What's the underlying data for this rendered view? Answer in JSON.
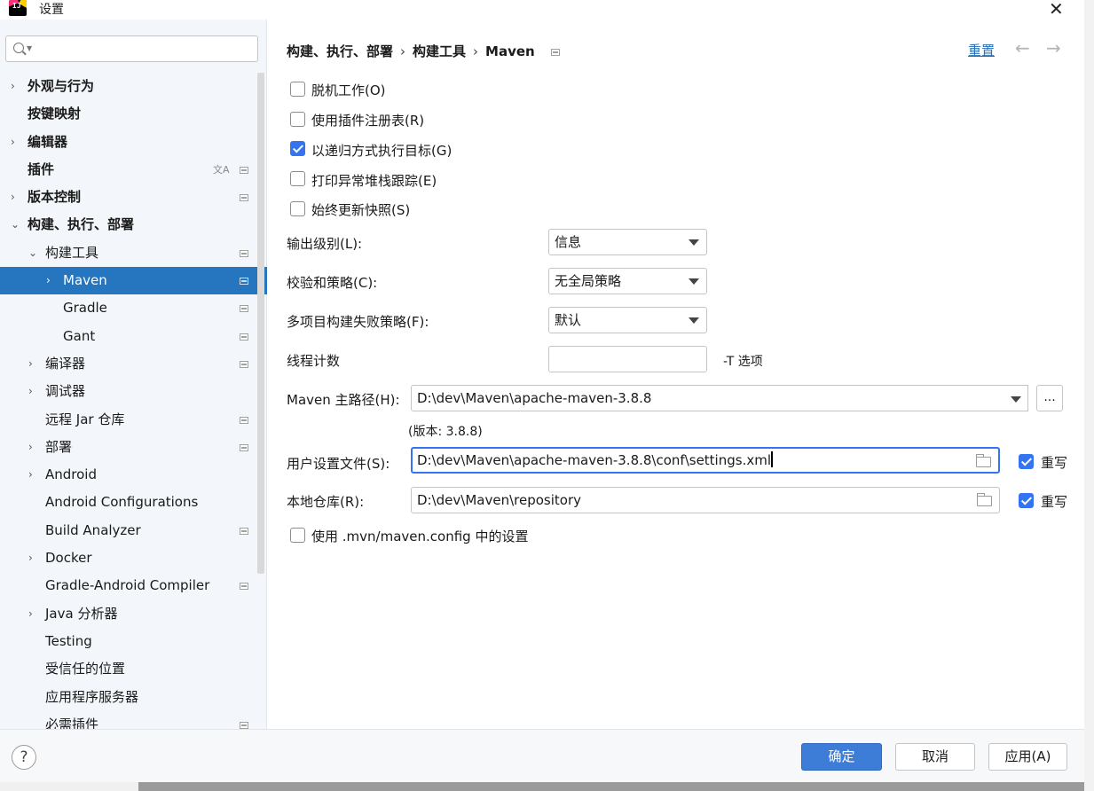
{
  "window": {
    "title": "设置",
    "close_glyph": "✕"
  },
  "search": {
    "placeholder": ""
  },
  "tree": [
    {
      "label": "外观与行为",
      "arrow": "›",
      "bold": true,
      "marker": false
    },
    {
      "label": "按键映射",
      "arrow": "",
      "bold": true,
      "marker": false
    },
    {
      "label": "编辑器",
      "arrow": "›",
      "bold": true,
      "marker": false
    },
    {
      "label": "插件",
      "arrow": "",
      "bold": true,
      "marker": true,
      "translate": true
    },
    {
      "label": "版本控制",
      "arrow": "›",
      "bold": true,
      "marker": true
    },
    {
      "label": "构建、执行、部署",
      "arrow": "⌄",
      "bold": true,
      "marker": false
    },
    {
      "label": "构建工具",
      "arrow": "⌄",
      "bold": false,
      "marker": true
    },
    {
      "label": "Maven",
      "arrow": "›",
      "bold": false,
      "marker": true,
      "selected": true
    },
    {
      "label": "Gradle",
      "arrow": "",
      "bold": false,
      "marker": true
    },
    {
      "label": "Gant",
      "arrow": "",
      "bold": false,
      "marker": true
    },
    {
      "label": "编译器",
      "arrow": "›",
      "bold": false,
      "marker": true
    },
    {
      "label": "调试器",
      "arrow": "›",
      "bold": false,
      "marker": false
    },
    {
      "label": "远程 Jar 仓库",
      "arrow": "",
      "bold": false,
      "marker": true
    },
    {
      "label": "部署",
      "arrow": "›",
      "bold": false,
      "marker": true
    },
    {
      "label": "Android",
      "arrow": "›",
      "bold": false,
      "marker": false
    },
    {
      "label": "Android Configurations",
      "arrow": "",
      "bold": false,
      "marker": false
    },
    {
      "label": "Build Analyzer",
      "arrow": "",
      "bold": false,
      "marker": true
    },
    {
      "label": "Docker",
      "arrow": "›",
      "bold": false,
      "marker": false
    },
    {
      "label": "Gradle-Android Compiler",
      "arrow": "",
      "bold": false,
      "marker": true
    },
    {
      "label": "Java 分析器",
      "arrow": "›",
      "bold": false,
      "marker": false
    },
    {
      "label": "Testing",
      "arrow": "",
      "bold": false,
      "marker": false
    },
    {
      "label": "受信任的位置",
      "arrow": "",
      "bold": false,
      "marker": false
    },
    {
      "label": "应用程序服务器",
      "arrow": "",
      "bold": false,
      "marker": false
    },
    {
      "label": "必需插件",
      "arrow": "",
      "bold": false,
      "marker": true
    }
  ],
  "breadcrumb": {
    "items": [
      "构建、执行、部署",
      "构建工具",
      "Maven"
    ],
    "sep": "›",
    "reset": "重置",
    "back": "←",
    "forward": "→"
  },
  "options": {
    "offline": {
      "label": "脱机工作(O)",
      "checked": false
    },
    "plugin_registry": {
      "label": "使用插件注册表(R)",
      "checked": false
    },
    "recursive": {
      "label": "以递归方式执行目标(G)",
      "checked": true
    },
    "stacktrace": {
      "label": "打印异常堆栈跟踪(E)",
      "checked": false
    },
    "snapshots": {
      "label": "始终更新快照(S)",
      "checked": false
    },
    "mvn_config": {
      "label": "使用 .mvn/maven.config 中的设置",
      "checked": false
    }
  },
  "fields": {
    "output_level": {
      "label": "输出级别(L):",
      "value": "信息"
    },
    "checksum": {
      "label": "校验和策略(C):",
      "value": "无全局策略"
    },
    "multiproject": {
      "label": "多项目构建失败策略(F):",
      "value": "默认"
    },
    "threads": {
      "label": "线程计数",
      "value": "",
      "suffix": "-T 选项"
    },
    "maven_home": {
      "label": "Maven 主路径(H):",
      "value": "D:\\dev\\Maven\\apache-maven-3.8.8",
      "version": "(版本: 3.8.8)",
      "browse": "..."
    },
    "user_settings": {
      "label": "用户设置文件(S):",
      "value": "D:\\dev\\Maven\\apache-maven-3.8.8\\conf\\settings.xml",
      "override_label": "重写",
      "override": true
    },
    "local_repo": {
      "label": "本地仓库(R):",
      "value": "D:\\dev\\Maven\\repository",
      "override_label": "重写",
      "override": true
    }
  },
  "footer": {
    "help": "?",
    "ok": "确定",
    "cancel": "取消",
    "apply": "应用(A)"
  },
  "colors": {
    "accent": "#3574f0",
    "selection": "#2675bf",
    "link": "#2a6fb4"
  }
}
